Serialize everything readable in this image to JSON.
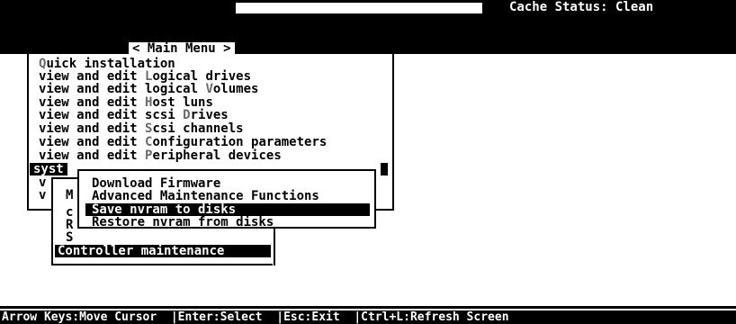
{
  "header": {
    "cache_status": "Cache Status: Clean"
  },
  "main_menu": {
    "title": "< Main Menu >",
    "items": [
      {
        "hotkey": "Q",
        "rest": "uick installation"
      },
      {
        "pre": "view and edit ",
        "hotkey": "L",
        "rest": "ogical drives"
      },
      {
        "pre": "view and edit logical ",
        "hotkey": "V",
        "rest": "olumes"
      },
      {
        "pre": "view and edit ",
        "hotkey": "H",
        "rest": "ost luns"
      },
      {
        "pre": "view and edit scsi ",
        "hotkey": "D",
        "rest": "rives"
      },
      {
        "pre": "view and edit ",
        "hotkey": "S",
        "rest": "csi channels"
      },
      {
        "pre": "view and edit ",
        "hotkey": "C",
        "rest": "onfiguration parameters"
      },
      {
        "pre": "view and edit ",
        "hotkey": "P",
        "rest": "eripheral devices"
      },
      {
        "label": "syst"
      },
      {
        "label": "v"
      },
      {
        "label": "v"
      }
    ]
  },
  "submenu": {
    "letters": [
      "M",
      "c",
      "R",
      "S"
    ],
    "selected": "Controller maintenance"
  },
  "maintenance_menu": {
    "items": [
      "Download Firmware",
      "Advanced Maintenance Functions",
      "Save nvram to disks",
      "Restore nvram from disks"
    ]
  },
  "status_bar": {
    "text": "Arrow Keys:Move Cursor  |Enter:Select  |Esc:Exit  |Ctrl+L:Refresh Screen"
  }
}
